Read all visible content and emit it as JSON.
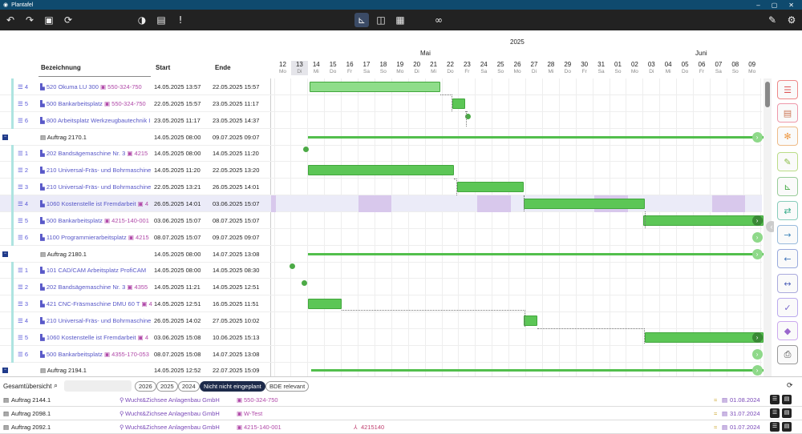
{
  "window": {
    "title": "Plantafel",
    "controls": [
      "–",
      "▢",
      "✕"
    ]
  },
  "toolbar": {
    "left_icons": [
      "undo-icon",
      "redo-icon",
      "save-icon",
      "refresh-icon",
      "brain-icon",
      "calendar-icon",
      "alert-icon"
    ],
    "center_icons": [
      "chart-icon",
      "split-view-icon",
      "grid-icon",
      "glasses-icon"
    ],
    "right_icons": [
      "brush-icon",
      "settings-icon"
    ]
  },
  "timescale": {
    "year": "2025",
    "months": [
      {
        "label": "Mai"
      },
      {
        "label": "Juni"
      }
    ],
    "days": [
      {
        "n": "12",
        "w": "Mo"
      },
      {
        "n": "13",
        "w": "Di"
      },
      {
        "n": "14",
        "w": "Mi"
      },
      {
        "n": "15",
        "w": "Do"
      },
      {
        "n": "16",
        "w": "Fr"
      },
      {
        "n": "17",
        "w": "Sa"
      },
      {
        "n": "18",
        "w": "So"
      },
      {
        "n": "19",
        "w": "Mo"
      },
      {
        "n": "20",
        "w": "Di"
      },
      {
        "n": "21",
        "w": "Mi"
      },
      {
        "n": "22",
        "w": "Do"
      },
      {
        "n": "23",
        "w": "Fr"
      },
      {
        "n": "24",
        "w": "Sa"
      },
      {
        "n": "25",
        "w": "So"
      },
      {
        "n": "26",
        "w": "Mo"
      },
      {
        "n": "27",
        "w": "Di"
      },
      {
        "n": "28",
        "w": "Mi"
      },
      {
        "n": "29",
        "w": "Do"
      },
      {
        "n": "30",
        "w": "Fr"
      },
      {
        "n": "31",
        "w": "Sa"
      },
      {
        "n": "01",
        "w": "So"
      },
      {
        "n": "02",
        "w": "Mo"
      },
      {
        "n": "03",
        "w": "Di"
      },
      {
        "n": "04",
        "w": "Mi"
      },
      {
        "n": "05",
        "w": "Do"
      },
      {
        "n": "06",
        "w": "Fr"
      },
      {
        "n": "07",
        "w": "Sa"
      },
      {
        "n": "08",
        "w": "So"
      },
      {
        "n": "09",
        "w": "Mo"
      }
    ]
  },
  "columns": {
    "name": "Bezeichnung",
    "start": "Start",
    "end": "Ende"
  },
  "rows": [
    {
      "type": "op",
      "seq": "4",
      "name": "520 Okuma LU 300",
      "res": "550-324-750",
      "start": "14.05.2025 13:57",
      "end": "22.05.2025 15:57"
    },
    {
      "type": "op",
      "seq": "5",
      "name": "500 Bankarbeitsplatz",
      "res": "550-324-750",
      "start": "22.05.2025 15:57",
      "end": "23.05.2025 11:17"
    },
    {
      "type": "op",
      "seq": "6",
      "name": "800 Arbeitsplatz Werkzeugbautechnik I",
      "res": "",
      "start": "23.05.2025 11:17",
      "end": "23.05.2025 14:37"
    },
    {
      "type": "order",
      "name": "Auftrag 2170.1",
      "start": "14.05.2025 08:00",
      "end": "09.07.2025 09:07"
    },
    {
      "type": "op",
      "seq": "1",
      "name": "202 Bandsägemaschine Nr. 3",
      "res": "4215",
      "start": "14.05.2025 08:00",
      "end": "14.05.2025 11:20"
    },
    {
      "type": "op",
      "seq": "2",
      "name": "210 Universal-Fräs- und Bohrmaschine",
      "res": "",
      "start": "14.05.2025 11:20",
      "end": "22.05.2025 13:20"
    },
    {
      "type": "op",
      "seq": "3",
      "name": "210 Universal-Fräs- und Bohrmaschine",
      "res": "",
      "start": "22.05.2025 13:21",
      "end": "26.05.2025 14:01"
    },
    {
      "type": "op",
      "seq": "4",
      "name": "1060 Kostenstelle ist Fremdarbeit",
      "res": "4",
      "start": "26.05.2025 14:01",
      "end": "03.06.2025 15:07"
    },
    {
      "type": "op",
      "seq": "5",
      "name": "500 Bankarbeitsplatz",
      "res": "4215-140-001",
      "start": "03.06.2025 15:07",
      "end": "08.07.2025 15:07"
    },
    {
      "type": "op",
      "seq": "6",
      "name": "1100 Programmierarbeitsplatz",
      "res": "4215",
      "start": "08.07.2025 15:07",
      "end": "09.07.2025 09:07"
    },
    {
      "type": "order",
      "name": "Auftrag 2180.1",
      "start": "14.05.2025 08:00",
      "end": "14.07.2025 13:08"
    },
    {
      "type": "op",
      "seq": "1",
      "name": "101 CAD/CAM Arbeitsplatz ProfiCAM",
      "res": "",
      "start": "14.05.2025 08:00",
      "end": "14.05.2025 08:30"
    },
    {
      "type": "op",
      "seq": "2",
      "name": "202 Bandsägemaschine Nr. 3",
      "res": "4355",
      "start": "14.05.2025 11:21",
      "end": "14.05.2025 12:51"
    },
    {
      "type": "op",
      "seq": "3",
      "name": "421 CNC-Fräsmaschine DMU 60 T",
      "res": "4",
      "start": "14.05.2025 12:51",
      "end": "16.05.2025 11:51"
    },
    {
      "type": "op",
      "seq": "4",
      "name": "210 Universal-Fräs- und Bohrmaschine",
      "res": "",
      "start": "26.05.2025 14:02",
      "end": "27.05.2025 10:02"
    },
    {
      "type": "op",
      "seq": "5",
      "name": "1060 Kostenstelle ist Fremdarbeit",
      "res": "4",
      "start": "03.06.2025 15:08",
      "end": "10.06.2025 15:13"
    },
    {
      "type": "op",
      "seq": "6",
      "name": "500 Bankarbeitsplatz",
      "res": "4355-170-053",
      "start": "08.07.2025 15:08",
      "end": "14.07.2025 13:08"
    },
    {
      "type": "order",
      "name": "Auftrag 2194.1",
      "start": "14.05.2025 12:52",
      "end": "22.07.2025 15:09"
    }
  ],
  "bottom": {
    "title": "Gesamtübersicht",
    "search_placeholder": "",
    "filters": [
      "2026",
      "2025",
      "2024",
      "Nicht nicht eingeplant",
      "BDE relevant"
    ],
    "active_filter": "Nicht nicht eingeplant",
    "rows": [
      {
        "order": "Auftrag 2144.1",
        "customer": "Wucht&Zichsee Anlagenbau GmbH",
        "article": "550-324-750",
        "extra": "",
        "date": "01.08.2024"
      },
      {
        "order": "Auftrag 2098.1",
        "customer": "Wucht&Zichsee Anlagenbau GmbH",
        "article": "W-Test",
        "extra": "",
        "date": "31.07.2024"
      },
      {
        "order": "Auftrag 2092.1",
        "customer": "Wucht&Zichsee Anlagenbau GmbH",
        "article": "4215-140-001",
        "extra": "4215140",
        "date": "01.07.2024"
      }
    ]
  },
  "colors": {
    "bar": "#5cc656",
    "accent": "#1d2a4a",
    "titlebar": "#0f4a6e"
  }
}
